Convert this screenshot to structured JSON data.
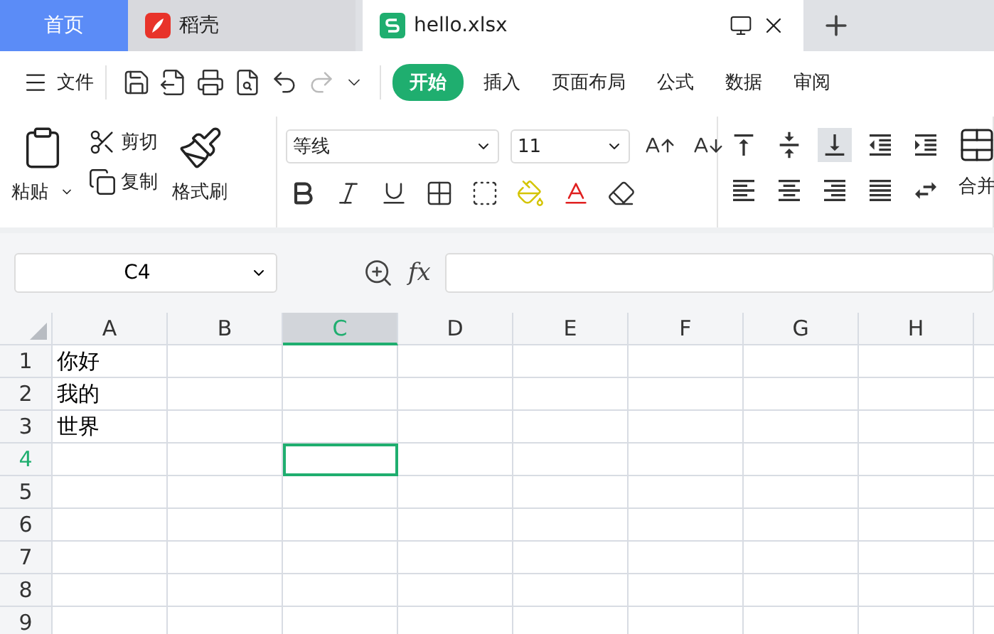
{
  "tabs": [
    {
      "label": "首页",
      "kind": "home",
      "selected": false
    },
    {
      "label": "稻壳",
      "kind": "app",
      "selected": false
    },
    {
      "label": "hello.xlsx",
      "kind": "sheet",
      "selected": true
    }
  ],
  "menu": {
    "file": "文件",
    "quick_access": [
      {
        "kind": "save",
        "disabled": false
      },
      {
        "kind": "export",
        "disabled": false
      },
      {
        "kind": "print",
        "disabled": false
      },
      {
        "kind": "preview",
        "disabled": false
      },
      {
        "kind": "undo",
        "disabled": false
      },
      {
        "kind": "redo",
        "disabled": true
      },
      {
        "kind": "more",
        "disabled": false
      }
    ],
    "ribbon_tabs": [
      {
        "label": "开始",
        "selected": true
      },
      {
        "label": "插入",
        "selected": false
      },
      {
        "label": "页面布局",
        "selected": false
      },
      {
        "label": "公式",
        "selected": false
      },
      {
        "label": "数据",
        "selected": false
      },
      {
        "label": "审阅",
        "selected": false
      }
    ]
  },
  "ribbon": {
    "paste": "粘贴",
    "cut": "剪切",
    "copy": "复制",
    "format_painter": "格式刷",
    "font": "等线",
    "size": "11",
    "merge": "合并",
    "vertical_align": [
      {
        "kind": "top",
        "selected": false
      },
      {
        "kind": "middle",
        "selected": false
      },
      {
        "kind": "bottom",
        "selected": true
      }
    ]
  },
  "name_box": "C4",
  "formula_label": "fx",
  "sheet": {
    "columns": [
      {
        "label": "A",
        "selected": false
      },
      {
        "label": "B",
        "selected": false
      },
      {
        "label": "C",
        "selected": true
      },
      {
        "label": "D",
        "selected": false
      },
      {
        "label": "E",
        "selected": false
      },
      {
        "label": "F",
        "selected": false
      },
      {
        "label": "G",
        "selected": false
      },
      {
        "label": "H",
        "selected": false
      }
    ],
    "rows": [
      {
        "label": "1",
        "selected": false,
        "cells": [
          "你好"
        ]
      },
      {
        "label": "2",
        "selected": false,
        "cells": [
          "我的"
        ]
      },
      {
        "label": "3",
        "selected": false,
        "cells": [
          "世界"
        ]
      },
      {
        "label": "4",
        "selected": true
      },
      {
        "label": "5",
        "selected": false
      },
      {
        "label": "6",
        "selected": false
      },
      {
        "label": "7",
        "selected": false
      },
      {
        "label": "8",
        "selected": false
      },
      {
        "label": "9",
        "selected": false
      }
    ]
  }
}
